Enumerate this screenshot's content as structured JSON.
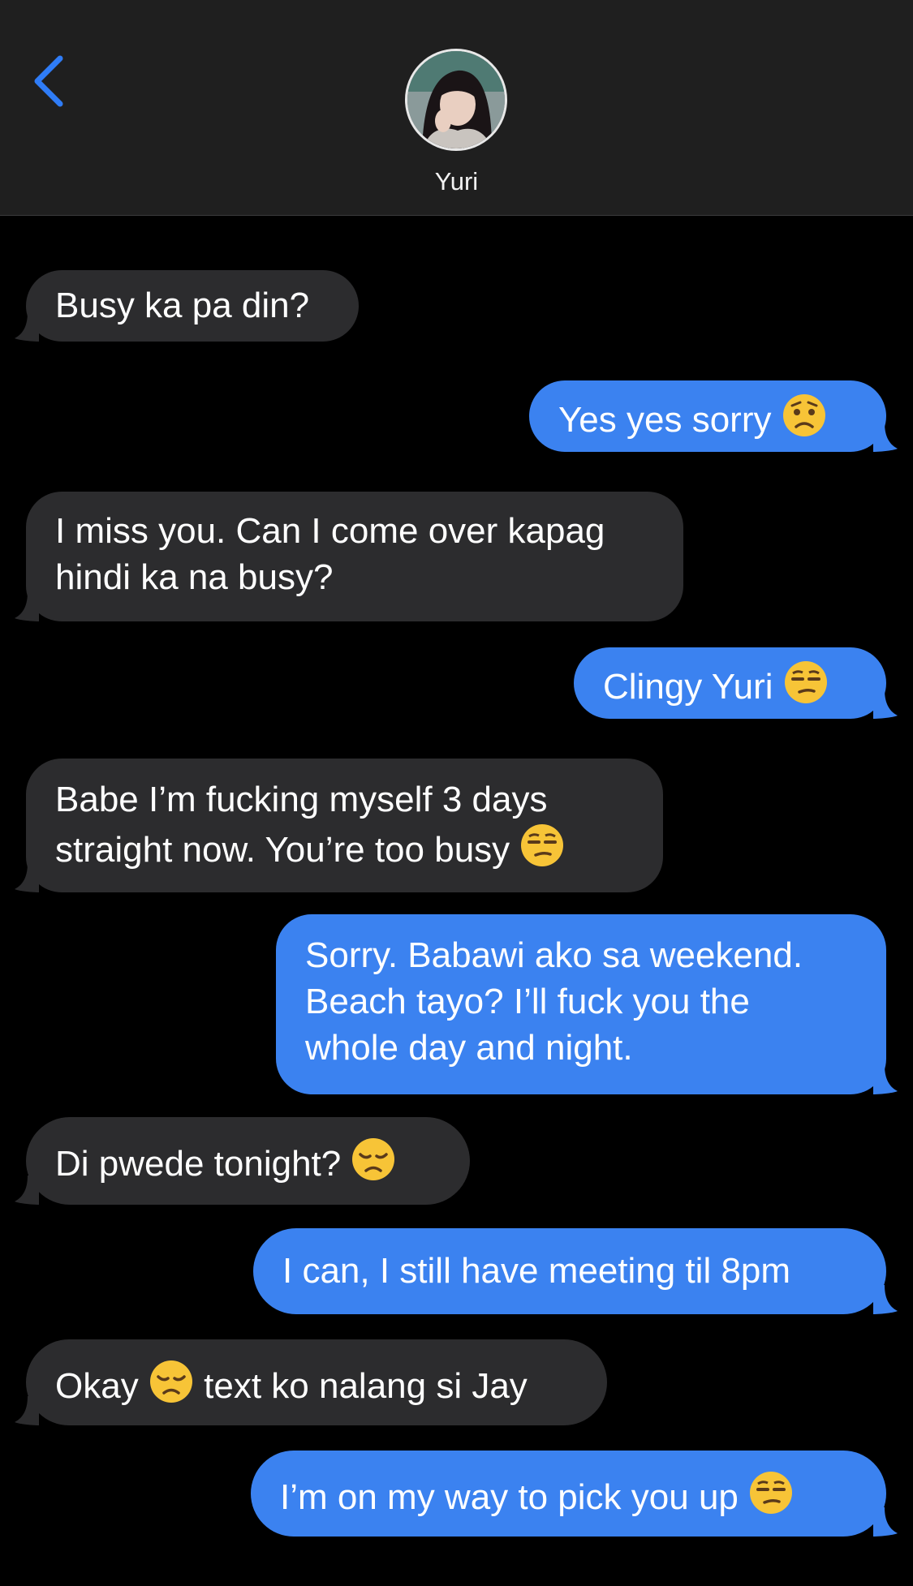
{
  "header": {
    "back_icon": "chevron-left-icon",
    "contact_name": "Yuri",
    "avatar": "contact-photo"
  },
  "colors": {
    "header_bg": "#1f1f1f",
    "thread_bg": "#000000",
    "incoming_bubble": "#2c2c2e",
    "outgoing_bubble": "#3b82f0",
    "accent": "#2f7cf6"
  },
  "messages": [
    {
      "dir": "in",
      "lines": [
        "Busy ka pa din?"
      ]
    },
    {
      "dir": "out",
      "lines": [
        "Yes yes sorry "
      ],
      "emoji": "worried-face"
    },
    {
      "dir": "in",
      "lines": [
        "I miss you. Can I come over kapag",
        "hindi ka na busy?"
      ]
    },
    {
      "dir": "out",
      "lines": [
        "Clingy Yuri "
      ],
      "emoji": "unamused-face"
    },
    {
      "dir": "in",
      "lines": [
        "Babe I’m fucking myself 3 days",
        "straight now. You’re too busy "
      ],
      "emoji": "unamused-face"
    },
    {
      "dir": "out",
      "lines": [
        "Sorry. Babawi ako sa weekend.",
        "Beach tayo? I’ll fuck you the",
        "whole day and night."
      ]
    },
    {
      "dir": "in",
      "lines": [
        "Di pwede tonight? "
      ],
      "emoji": "disappointed-face"
    },
    {
      "dir": "out",
      "lines": [
        "I can, I still have meeting til 8pm"
      ]
    },
    {
      "dir": "in",
      "lines": [
        "Okay ",
        " text ko nalang si Jay"
      ],
      "emoji": "disappointed-face",
      "emoji_inline_mid": true
    },
    {
      "dir": "out",
      "lines": [
        "I’m on my way to pick you up "
      ],
      "emoji": "unamused-face"
    }
  ]
}
